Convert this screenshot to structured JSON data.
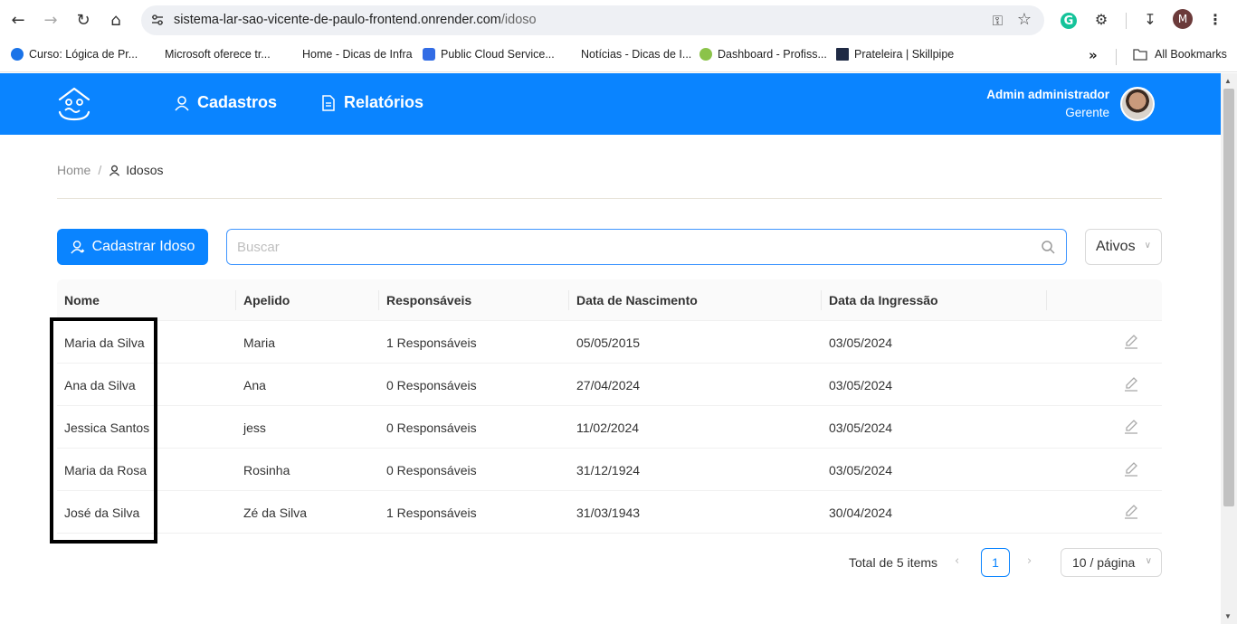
{
  "browser": {
    "url_host": "sistema-lar-sao-vicente-de-paulo-frontend.onrender.com",
    "url_path": "/idoso",
    "profile_initial": "M",
    "bookmarks": [
      {
        "label": "Curso: Lógica de Pr...",
        "color": "#1a73e8"
      },
      {
        "label": "Microsoft oferece tr...",
        "color": "#ffffff"
      },
      {
        "label": "Home - Dicas de Infra",
        "color": "#ffffff"
      },
      {
        "label": "Public Cloud Service...",
        "color": "#326ce5"
      },
      {
        "label": "Notícias - Dicas de I...",
        "color": "#ffffff"
      },
      {
        "label": "Dashboard - Profiss...",
        "color": "#8bc34a"
      },
      {
        "label": "Prateleira | Skillpipe",
        "color": "#1f2a44"
      }
    ],
    "more_label": "»",
    "all_bookmarks_label": "All Bookmarks"
  },
  "header": {
    "menu": [
      {
        "label": "Cadastros",
        "icon": "user-icon"
      },
      {
        "label": "Relatórios",
        "icon": "file-icon"
      }
    ],
    "user_name": "Admin administrador",
    "user_role": "Gerente"
  },
  "breadcrumb": {
    "home": "Home",
    "separator": "/",
    "current": "Idosos"
  },
  "toolbar": {
    "add_button": "Cadastrar Idoso",
    "search_placeholder": "Buscar",
    "status_filter": "Ativos"
  },
  "table": {
    "columns": [
      "Nome",
      "Apelido",
      "Responsáveis",
      "Data de Nascimento",
      "Data da Ingressão"
    ],
    "rows": [
      {
        "nome": "Maria da Silva",
        "apelido": "Maria",
        "responsaveis": "1 Responsáveis",
        "nascimento": "05/05/2015",
        "ingressao": "03/05/2024"
      },
      {
        "nome": "Ana da Silva",
        "apelido": "Ana",
        "responsaveis": "0 Responsáveis",
        "nascimento": "27/04/2024",
        "ingressao": "03/05/2024"
      },
      {
        "nome": "Jessica Santos",
        "apelido": "jess",
        "responsaveis": "0 Responsáveis",
        "nascimento": "11/02/2024",
        "ingressao": "03/05/2024"
      },
      {
        "nome": "Maria da Rosa",
        "apelido": "Rosinha",
        "responsaveis": "0 Responsáveis",
        "nascimento": "31/12/1924",
        "ingressao": "03/05/2024"
      },
      {
        "nome": "José da Silva",
        "apelido": "Zé da Silva",
        "responsaveis": "1 Responsáveis",
        "nascimento": "31/03/1943",
        "ingressao": "30/04/2024"
      }
    ]
  },
  "pagination": {
    "total": "Total de 5 items",
    "current_page": "1",
    "page_size": "10 / página"
  },
  "colors": {
    "primary": "#0a84ff",
    "highlight_border": "#000000"
  }
}
